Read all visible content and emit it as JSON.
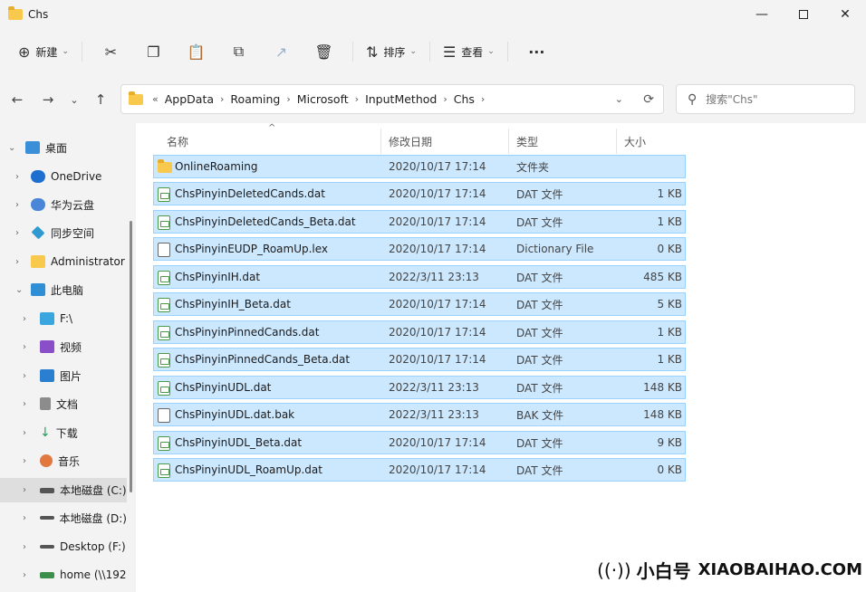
{
  "window": {
    "title": "Chs",
    "controls": {
      "minimize": "—",
      "close": "✕"
    }
  },
  "commandbar": {
    "new_icon": "⊕",
    "new_label": "新建",
    "cut_icon": "✂",
    "copy_icon": "❐",
    "paste_icon": "📋",
    "rename_icon": "⧉",
    "share_icon": "↗",
    "delete_icon": "🗑",
    "sort_icon": "⇅",
    "sort_label": "排序",
    "view_icon": "☰",
    "view_label": "查看",
    "more_icon": "···",
    "caret": "⌄"
  },
  "nav": {
    "back": "←",
    "forward": "→",
    "recent": "⌄",
    "up": "↑"
  },
  "address": {
    "overflow": "«",
    "crumbs": [
      "AppData",
      "Roaming",
      "Microsoft",
      "InputMethod",
      "Chs"
    ],
    "separator": "›",
    "dropdown": "⌄",
    "refresh": "⟳"
  },
  "search": {
    "icon": "⚲",
    "placeholder": "搜索\"Chs\""
  },
  "sidebar": {
    "expand_open": "⌄",
    "expand_closed": "›",
    "items": [
      {
        "label": "桌面"
      },
      {
        "label": "OneDrive"
      },
      {
        "label": "华为云盘"
      },
      {
        "label": "同步空间"
      },
      {
        "label": "Administrator"
      },
      {
        "label": "此电脑"
      },
      {
        "label": "F:\\"
      },
      {
        "label": "视频"
      },
      {
        "label": "图片"
      },
      {
        "label": "文档"
      },
      {
        "label": "下载"
      },
      {
        "label": "音乐"
      },
      {
        "label": "本地磁盘 (C:)"
      },
      {
        "label": "本地磁盘 (D:)"
      },
      {
        "label": "Desktop (F:)"
      },
      {
        "label": "home (\\\\192"
      }
    ]
  },
  "filelist": {
    "sort_indicator": "^",
    "columns": {
      "name": "名称",
      "date": "修改日期",
      "type": "类型",
      "size": "大小"
    },
    "rows": [
      {
        "name": "OnlineRoaming",
        "date": "2020/10/17 17:14",
        "type": "文件夹",
        "size": ""
      },
      {
        "name": "ChsPinyinDeletedCands.dat",
        "date": "2020/10/17 17:14",
        "type": "DAT 文件",
        "size": "1 KB"
      },
      {
        "name": "ChsPinyinDeletedCands_Beta.dat",
        "date": "2020/10/17 17:14",
        "type": "DAT 文件",
        "size": "1 KB"
      },
      {
        "name": "ChsPinyinEUDP_RoamUp.lex",
        "date": "2020/10/17 17:14",
        "type": "Dictionary File",
        "size": "0 KB"
      },
      {
        "name": "ChsPinyinIH.dat",
        "date": "2022/3/11 23:13",
        "type": "DAT 文件",
        "size": "485 KB"
      },
      {
        "name": "ChsPinyinIH_Beta.dat",
        "date": "2020/10/17 17:14",
        "type": "DAT 文件",
        "size": "5 KB"
      },
      {
        "name": "ChsPinyinPinnedCands.dat",
        "date": "2020/10/17 17:14",
        "type": "DAT 文件",
        "size": "1 KB"
      },
      {
        "name": "ChsPinyinPinnedCands_Beta.dat",
        "date": "2020/10/17 17:14",
        "type": "DAT 文件",
        "size": "1 KB"
      },
      {
        "name": "ChsPinyinUDL.dat",
        "date": "2022/3/11 23:13",
        "type": "DAT 文件",
        "size": "148 KB"
      },
      {
        "name": "ChsPinyinUDL.dat.bak",
        "date": "2022/3/11 23:13",
        "type": "BAK 文件",
        "size": "148 KB"
      },
      {
        "name": "ChsPinyinUDL_Beta.dat",
        "date": "2020/10/17 17:14",
        "type": "DAT 文件",
        "size": "9 KB"
      },
      {
        "name": "ChsPinyinUDL_RoamUp.dat",
        "date": "2020/10/17 17:14",
        "type": "DAT 文件",
        "size": "0 KB"
      }
    ]
  },
  "watermark": {
    "icon": "((·))",
    "cn": "小白号",
    "en": "XIAOBAIHAO.COM"
  },
  "colors": {
    "selection": "#cce8ff",
    "selection_border": "#99d1ff",
    "folder": "#f8c94c"
  }
}
